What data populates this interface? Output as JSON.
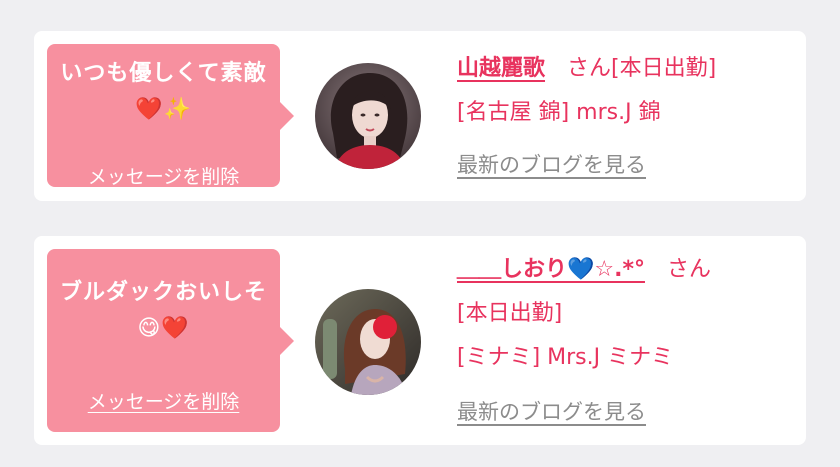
{
  "favorites": [
    {
      "message": "いつも優しくて素敵❤️✨",
      "delete_label": "メッセージを削除",
      "name": "山越麗歌",
      "honorific": "さん",
      "status": "[本日出勤]",
      "shop": "[名古屋 錦] mrs.J 錦",
      "blog_link": "最新のブログを見る",
      "avatar_icon": "woman-portrait-avatar"
    },
    {
      "message": "ブルダックおいしそ😋❤️",
      "delete_label": "メッセージを削除",
      "name": "＿＿しおり💙☆.*°",
      "honorific": "さん",
      "status": "[本日出勤]",
      "shop": "[ミナミ] Mrs.J ミナミ",
      "blog_link": "最新のブログを見る",
      "avatar_icon": "woman-portrait-avatar"
    }
  ],
  "colors": {
    "background": "#efeff2",
    "bubble": "#f7909f",
    "accent": "#e8335e",
    "link_gray": "#8c8c8c"
  }
}
